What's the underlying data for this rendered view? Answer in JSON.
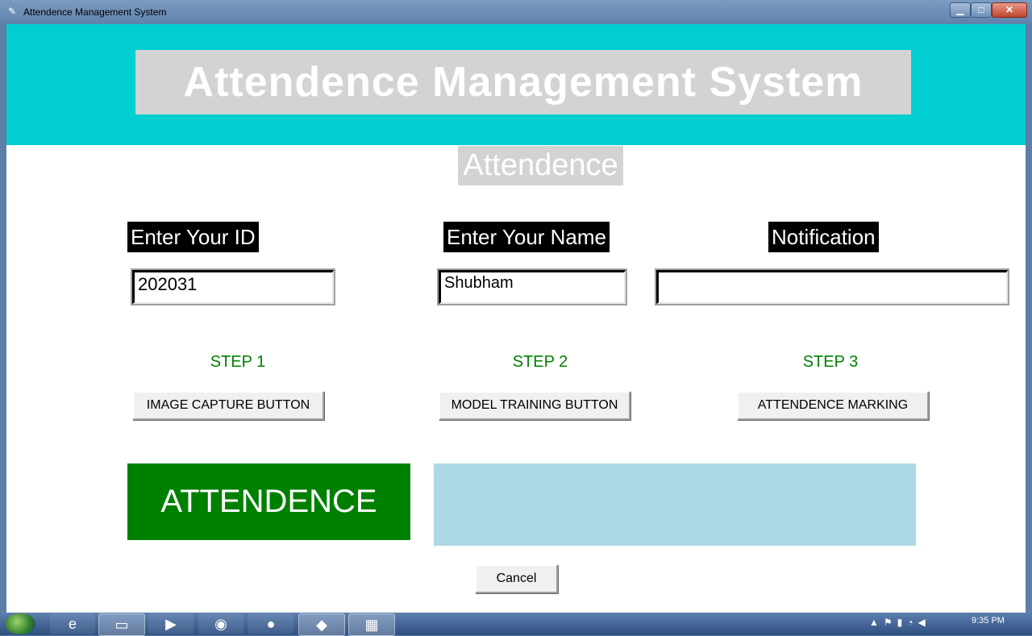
{
  "window": {
    "title": "Attendence Management System",
    "minimize_glyph": "▁",
    "maximize_glyph": "□",
    "close_glyph": "✕"
  },
  "app": {
    "banner_title": "Attendence Management System",
    "subheading": "Attendence"
  },
  "form": {
    "id_label": "Enter Your ID",
    "id_value": "202031",
    "name_label": "Enter Your Name",
    "name_value": "Shubham",
    "notification_label": "Notification",
    "notification_value": ""
  },
  "steps": [
    {
      "label": "STEP 1",
      "button": "IMAGE CAPTURE BUTTON"
    },
    {
      "label": "STEP 2",
      "button": "MODEL TRAINING BUTTON"
    },
    {
      "label": "STEP 3",
      "button": "ATTENDENCE MARKING"
    }
  ],
  "attendance_panel": {
    "title": "ATTENDENCE",
    "notice_text": ""
  },
  "cancel_label": "Cancel",
  "taskbar": {
    "items": [
      "internet-explorer-icon",
      "folder-icon",
      "media-player-icon",
      "chrome-icon",
      "firefox-icon",
      "vscode-icon",
      "python-icon"
    ],
    "clock": "9:35 PM"
  },
  "colors": {
    "banner": "#00ced1",
    "title_bg": "#d3d3d3",
    "step_text": "#008000",
    "attendance_bg": "#008000",
    "notice_bg": "#add8e6"
  }
}
